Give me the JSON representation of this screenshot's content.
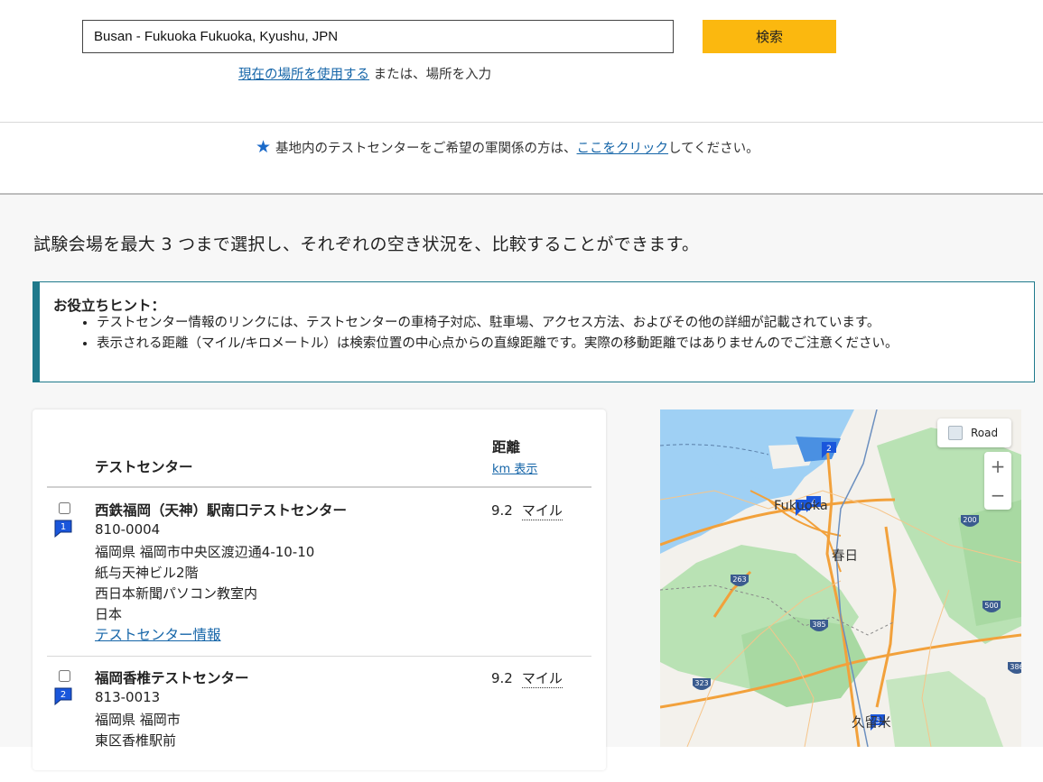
{
  "search": {
    "value": "Busan - Fukuoka Fukuoka, Kyushu, JPN",
    "button_label": "検索",
    "use_location_link": "現在の場所を使用する",
    "or_enter_text": "または、場所を入力"
  },
  "military": {
    "prefix": "基地内のテストセンターをご希望の軍関係の方は、",
    "link": "ここをクリック",
    "suffix": "してください。"
  },
  "intro_text": "試験会場を最大 3 つまで選択し、それぞれの空き状況を、比較することができます。",
  "tips": {
    "title": "お役立ちヒント：",
    "items": [
      "テストセンター情報のリンクには、テストセンターの車椅子対応、駐車場、アクセス方法、およびその他の詳細が記載されています。",
      "表示される距離（マイル/キロメートル）は検索位置の中心点からの直線距離です。実際の移動距離ではありませんのでご注意ください。"
    ]
  },
  "table": {
    "header_center": "テストセンター",
    "header_distance": "距離",
    "km_toggle": "km 表示",
    "rows": [
      {
        "pin": "1",
        "name": "西鉄福岡（天神）駅南口テストセンター",
        "postal": "810-0004",
        "address1": "福岡県 福岡市中央区渡辺通4-10-10",
        "address2": "紙与天神ビル2階",
        "address3": "西日本新聞パソコン教室内",
        "country": "日本",
        "info_link": "テストセンター情報",
        "distance": "9.2",
        "unit": "マイル"
      },
      {
        "pin": "2",
        "name": "福岡香椎テストセンター",
        "postal": "813-0013",
        "address1": "福岡県 福岡市",
        "address2": "東区香椎駅前",
        "distance": "9.2",
        "unit": "マイル"
      }
    ]
  },
  "map": {
    "road_button": "Road",
    "zoom_in": "+",
    "zoom_out": "−",
    "labels": {
      "fukuoka": "Fukuoka",
      "kasuga": "春日",
      "kurume": "久留米"
    },
    "route_shields": [
      "263",
      "385",
      "323",
      "200",
      "500",
      "386"
    ],
    "pins": [
      "1",
      "2",
      "4",
      "5"
    ]
  },
  "colors": {
    "accent_button": "#FBB80F",
    "link": "#1565A8",
    "tips_border": "#1F7A8C",
    "pin": "#1A56DB"
  }
}
